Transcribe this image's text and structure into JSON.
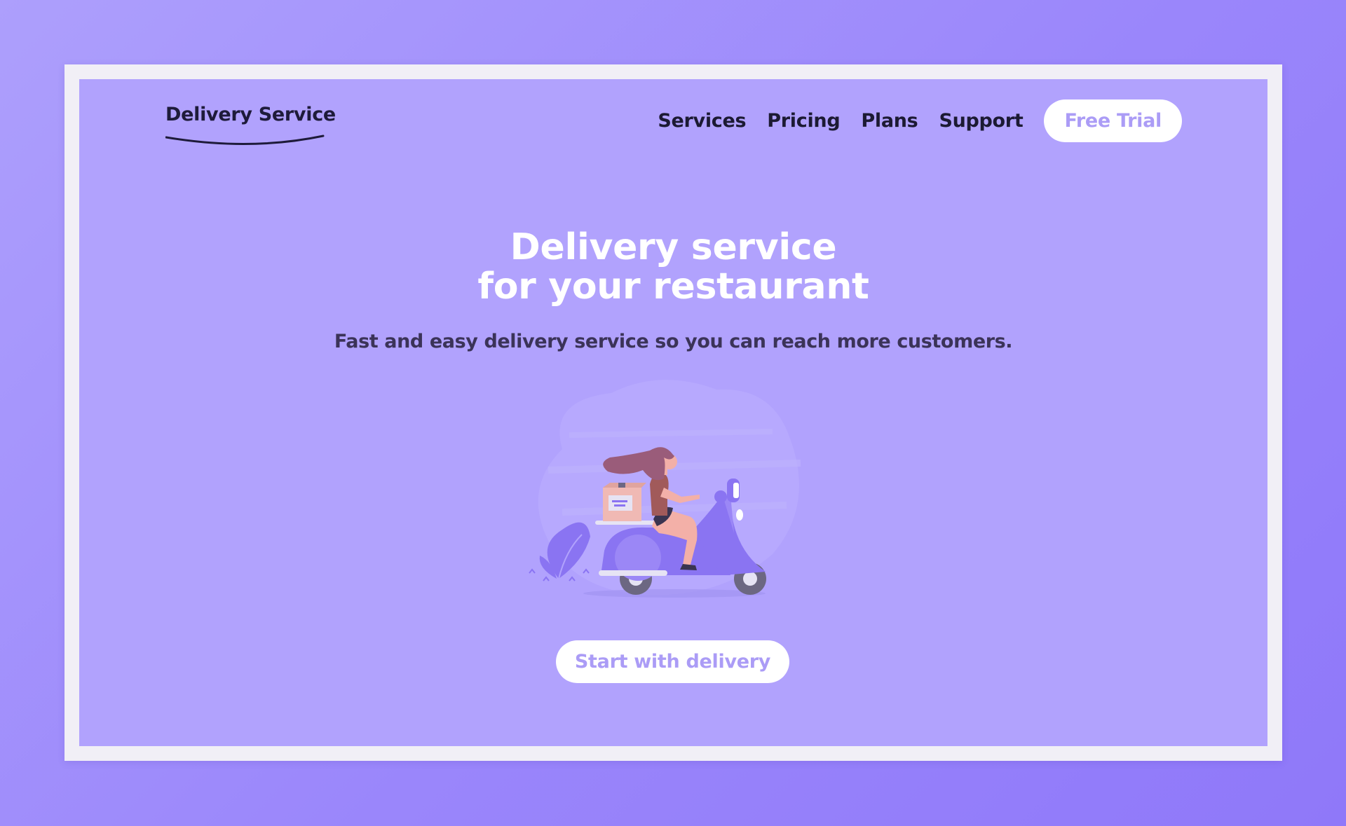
{
  "logo": {
    "text": "Delivery Service"
  },
  "nav": {
    "links": [
      "Services",
      "Pricing",
      "Plans",
      "Support"
    ],
    "cta_label": "Free Trial"
  },
  "hero": {
    "title_line1": "Delivery service",
    "title_line2": "for your restaurant",
    "subtitle": "Fast and easy delivery service so you can reach more customers.",
    "cta_label": "Start with delivery"
  },
  "colors": {
    "background": "#9f8ffb",
    "page": "#b1a2fd",
    "frame": "#f1eff6",
    "accent_text": "#ab9cf6",
    "heading": "#ffffff",
    "body_text": "#3b3358"
  },
  "icons": [
    "logo-swoosh-icon",
    "scooter-rider-illustration",
    "plant-icon"
  ]
}
